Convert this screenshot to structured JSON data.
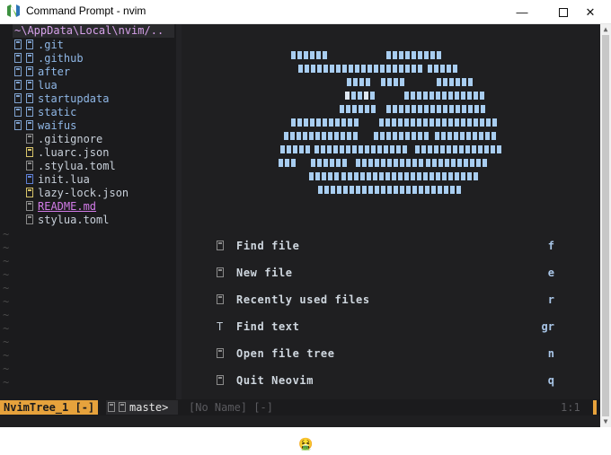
{
  "window": {
    "title": "Command Prompt - nvim",
    "minimize": "—",
    "close": "✕"
  },
  "tree": {
    "root": "~\\AppData\\Local\\nvim/..",
    "items": [
      {
        "name": ".git",
        "kind": "dir"
      },
      {
        "name": ".github",
        "kind": "dir"
      },
      {
        "name": "after",
        "kind": "dir"
      },
      {
        "name": "lua",
        "kind": "dir"
      },
      {
        "name": "startupdata",
        "kind": "dir"
      },
      {
        "name": "static",
        "kind": "dir"
      },
      {
        "name": "waifus",
        "kind": "dir"
      },
      {
        "name": ".gitignore",
        "kind": "file"
      },
      {
        "name": ".luarc.json",
        "kind": "json"
      },
      {
        "name": ".stylua.toml",
        "kind": "file"
      },
      {
        "name": "init.lua",
        "kind": "lua"
      },
      {
        "name": "lazy-lock.json",
        "kind": "json"
      },
      {
        "name": "README.md",
        "kind": "readme"
      },
      {
        "name": "stylua.toml",
        "kind": "file"
      }
    ],
    "tilde": "~"
  },
  "dashboard": {
    "items": [
      {
        "icon": "file-icon",
        "glyph": "",
        "label": "Find file",
        "key": "f"
      },
      {
        "icon": "new-file-icon",
        "glyph": "",
        "label": "New file",
        "key": "e"
      },
      {
        "icon": "history-icon",
        "glyph": "",
        "label": "Recently used files",
        "key": "r"
      },
      {
        "icon": "text-icon",
        "glyph": "T",
        "label": "Find text",
        "key": "gr"
      },
      {
        "icon": "tree-icon",
        "glyph": "",
        "label": "Open file tree",
        "key": "n"
      },
      {
        "icon": "quit-icon",
        "glyph": "",
        "label": "Quit Neovim",
        "key": "q"
      }
    ]
  },
  "statusline": {
    "mode": "NvimTree_1 [-]",
    "branch": "maste>",
    "buffer": "[No Name] [-]",
    "position": "1:1"
  },
  "taskbar": {
    "emoji": "🤮"
  },
  "colors": {
    "accent": "#e6a23c",
    "background": "#1f1f21",
    "directory": "#8fb7e6",
    "readme": "#d27be8"
  }
}
